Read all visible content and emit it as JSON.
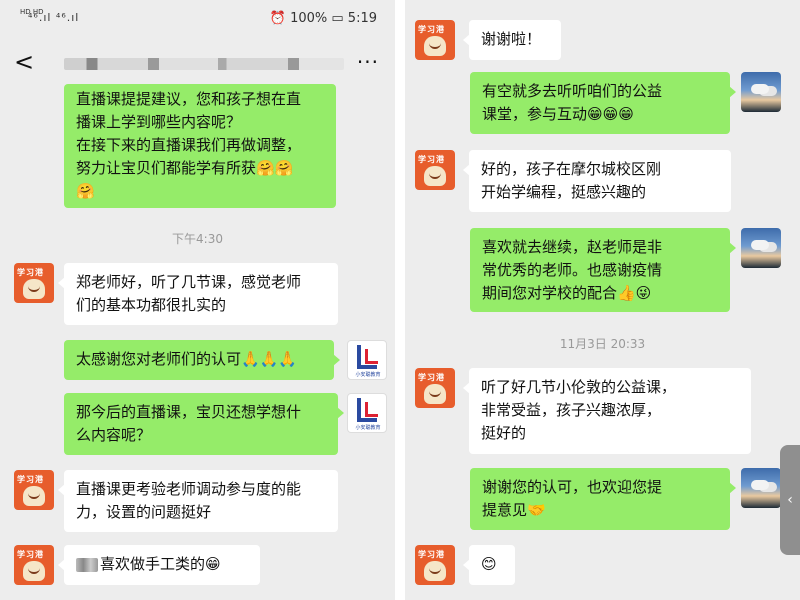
{
  "left": {
    "status": {
      "hd": "HD HD",
      "signal": "⁴⁶.ıl ⁴⁶.ıl",
      "battery": "100%",
      "time": "5:19"
    },
    "nav": {
      "back": "<",
      "more": "···"
    },
    "msgs": {
      "m1": [
        "直播课提提建议，您和孩子想在直",
        "播课上学到哪些内容呢？",
        "在接下来的直播课我们再做调整，",
        "努力让宝贝们都能学有所获🤗🤗",
        "🤗"
      ],
      "time1": "下午4:30",
      "m2": [
        "郑老师好，听了几节课，感觉老师",
        "们的基本功都很扎实的"
      ],
      "m3": [
        "太感谢您对老师们的认可🙏🙏🙏"
      ],
      "m4": [
        "那今后的直播课，宝贝还想学想什",
        "么内容呢？"
      ],
      "m5": [
        "直播课更考验老师调动参与度的能",
        "力，设置的问题挺好"
      ],
      "m6": "喜欢做手工类的😁"
    }
  },
  "right": {
    "msgs": {
      "r1": "谢谢啦！",
      "r2": [
        "有空就多去听听咱们的公益",
        "课堂，参与互动😁😁😁"
      ],
      "r3": [
        "好的，孩子在摩尔城校区刚",
        "开始学编程，挺感兴趣的"
      ],
      "r4": [
        "喜欢就去继续，赵老师是非",
        "常优秀的老师。也感谢疫情",
        "期间您对学校的配合👍😜"
      ],
      "time2": "11月3日 20:33",
      "r5": [
        "听了好几节小伦敦的公益课，",
        "非常受益，孩子兴趣浓厚，",
        "挺好的"
      ],
      "r6": [
        "谢谢您的认可，也欢迎您提",
        "提意见🤝"
      ],
      "r7": "😊"
    }
  },
  "avatars": {
    "school_text": "学习港",
    "logo_caption": "小安聪教育"
  },
  "float_btn": "‹",
  "colors": {
    "sent_bubble": "#95ec69",
    "received_bubble": "#ffffff",
    "background": "#ededed"
  }
}
